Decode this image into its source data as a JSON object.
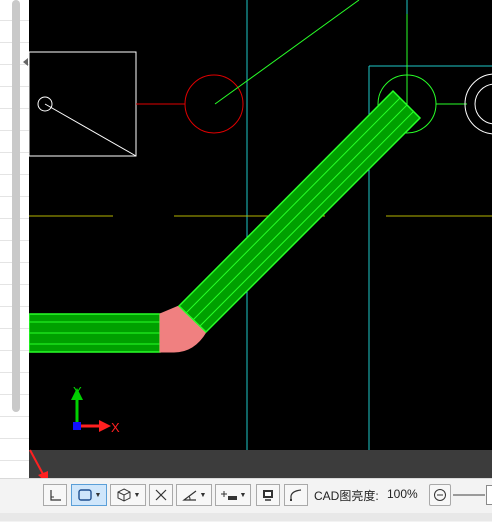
{
  "canvas": {
    "axis_x_label": "X",
    "axis_y_label": "Y"
  },
  "toolbar": {
    "brightness_label": "CAD图亮度:",
    "brightness_value": "100%",
    "buttons": [
      {
        "name": "ortho-icon",
        "dropdown": false,
        "active": false
      },
      {
        "name": "rectangle-frame-icon",
        "dropdown": true,
        "active": true
      },
      {
        "name": "cube-view-icon",
        "dropdown": true,
        "active": false
      },
      {
        "name": "cross-line-icon",
        "dropdown": false,
        "active": false
      },
      {
        "name": "angle-icon",
        "dropdown": true,
        "active": false
      },
      {
        "name": "snap-insert-icon",
        "dropdown": true,
        "active": false
      },
      {
        "name": "display-monitor-icon",
        "dropdown": false,
        "active": false
      },
      {
        "name": "curve-arc-icon",
        "dropdown": false,
        "active": false
      }
    ]
  },
  "colors": {
    "pipe_green": "#00a000",
    "pipe_edge": "#28ff28",
    "elbow_pink": "#f08080",
    "cad_red": "#e00000",
    "cad_cyan": "#1ec8c8",
    "cad_yellow": "#b5b500",
    "annotation_arrow": "#ff2020"
  }
}
